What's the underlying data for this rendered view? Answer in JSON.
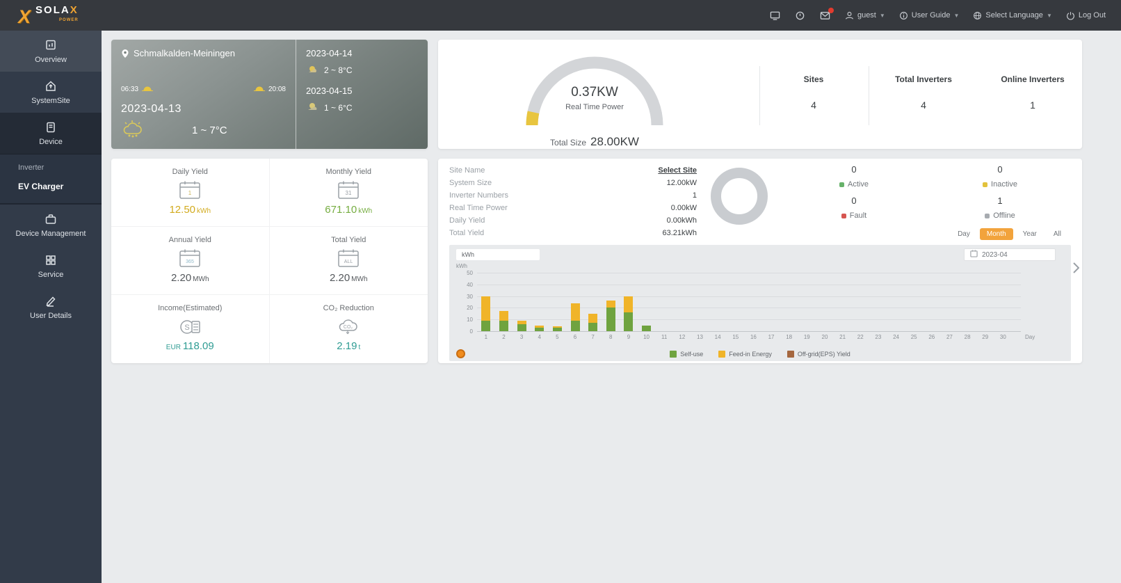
{
  "topbar": {
    "brand": "SOLA",
    "brand_x": "X",
    "brand_sub": "POWER",
    "user_label": "guest",
    "user_guide_label": "User Guide",
    "language_label": "Select Language",
    "logout_label": "Log Out"
  },
  "sidebar": {
    "items": [
      {
        "label": "Overview"
      },
      {
        "label": "SystemSite"
      },
      {
        "label": "Device"
      },
      {
        "label": "Device Management"
      },
      {
        "label": "Service"
      },
      {
        "label": "User Details"
      }
    ],
    "device_submenu": [
      {
        "label": "Inverter"
      },
      {
        "label": "EV Charger"
      }
    ]
  },
  "weather": {
    "location": "Schmalkalden-Meiningen",
    "sunrise": "06:33",
    "sunset": "20:08",
    "today_date": "2023-04-13",
    "today_temp": "1 ~ 7°C",
    "forecast": [
      {
        "date": "2023-04-14",
        "temp": "2 ~ 8°C"
      },
      {
        "date": "2023-04-15",
        "temp": "1 ~ 6°C"
      }
    ]
  },
  "overview_card": {
    "power_value": "0.37KW",
    "power_label": "Real Time Power",
    "total_size_label": "Total Size",
    "total_size_value": "28.00KW",
    "stats": [
      {
        "label": "Sites",
        "value": "4"
      },
      {
        "label": "Total Inverters",
        "value": "4"
      },
      {
        "label": "Online Inverters",
        "value": "1"
      }
    ]
  },
  "yield_card": {
    "tiles": [
      {
        "label": "Daily Yield",
        "prefix": "",
        "value": "12.50",
        "unit": "kWh",
        "color": "#d2ab1e"
      },
      {
        "label": "Monthly Yield",
        "prefix": "",
        "value": "671.10",
        "unit": "kWh",
        "color": "#76ad41"
      },
      {
        "label": "Annual Yield",
        "prefix": "",
        "value": "2.20",
        "unit": "MWh",
        "color": "#54585c"
      },
      {
        "label": "Total Yield",
        "prefix": "",
        "value": "2.20",
        "unit": "MWh",
        "color": "#54585c"
      },
      {
        "label": "Income(Estimated)",
        "prefix": "EUR",
        "value": "118.09",
        "unit": "",
        "color": "#2f9c93"
      },
      {
        "label": "CO₂ Reduction",
        "prefix": "",
        "value": "2.19",
        "unit": "t",
        "color": "#2f9c93"
      }
    ]
  },
  "site_card": {
    "details": [
      {
        "label": "Site Name",
        "value": "Select Site"
      },
      {
        "label": "System Size",
        "value": "12.00kW"
      },
      {
        "label": "Inverter Numbers",
        "value": "1"
      },
      {
        "label": "Real Time Power",
        "value": "0.00kW"
      },
      {
        "label": "Daily Yield",
        "value": "0.00kWh"
      },
      {
        "label": "Total Yield",
        "value": "63.21kWh"
      }
    ],
    "status": [
      {
        "label": "Active",
        "value": "0",
        "color": "#67b26a"
      },
      {
        "label": "Fault",
        "value": "0",
        "color": "#d65550"
      },
      {
        "label": "Inactive",
        "value": "0",
        "color": "#e2c23c"
      },
      {
        "label": "Offline",
        "value": "1",
        "color": "#a7abb0"
      }
    ],
    "range_options": [
      "Day",
      "Month",
      "Year",
      "All"
    ],
    "range_selected": "Month",
    "date_value": "2023-04",
    "unit_tab": "kWh"
  },
  "chart_data": {
    "type": "bar",
    "stacked": true,
    "title": "",
    "xlabel": "Day",
    "ylabel": "kWh",
    "ylim": [
      0,
      50
    ],
    "yticks": [
      50,
      40,
      30,
      20,
      10,
      0
    ],
    "grid": true,
    "legend_position": "bottom",
    "categories": [
      "1",
      "2",
      "3",
      "4",
      "5",
      "6",
      "7",
      "8",
      "9",
      "10",
      "11",
      "12",
      "13",
      "14",
      "15",
      "16",
      "17",
      "18",
      "19",
      "20",
      "21",
      "22",
      "23",
      "24",
      "25",
      "26",
      "27",
      "28",
      "29",
      "30"
    ],
    "series": [
      {
        "name": "Self-use",
        "color": "#6fa33f",
        "values": [
          9,
          9,
          6,
          3,
          3,
          9,
          7,
          20,
          16,
          5,
          0,
          0,
          0,
          0,
          0,
          0,
          0,
          0,
          0,
          0,
          0,
          0,
          0,
          0,
          0,
          0,
          0,
          0,
          0,
          0
        ]
      },
      {
        "name": "Feed-in Energy",
        "color": "#f0b429",
        "values": [
          21,
          8,
          3,
          2,
          1,
          15,
          8,
          6,
          14,
          0,
          0,
          0,
          0,
          0,
          0,
          0,
          0,
          0,
          0,
          0,
          0,
          0,
          0,
          0,
          0,
          0,
          0,
          0,
          0,
          0
        ]
      },
      {
        "name": "Off-grid(EPS) Yield",
        "color": "#a5673f",
        "values": [
          0,
          0,
          0,
          0,
          0,
          0,
          0,
          0,
          0,
          0,
          0,
          0,
          0,
          0,
          0,
          0,
          0,
          0,
          0,
          0,
          0,
          0,
          0,
          0,
          0,
          0,
          0,
          0,
          0,
          0
        ]
      }
    ]
  }
}
